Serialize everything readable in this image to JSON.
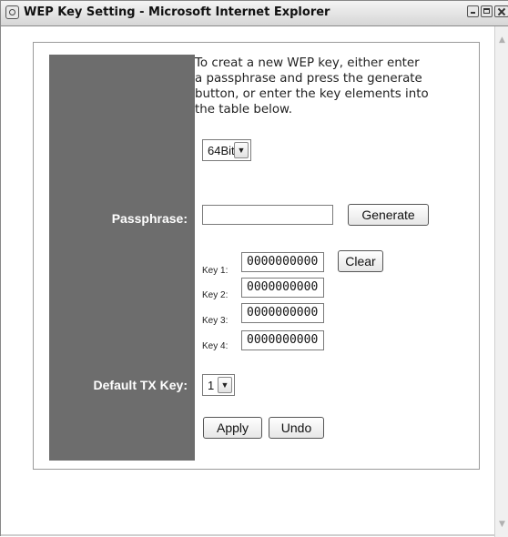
{
  "window": {
    "title": "WEP Key Setting - Microsoft Internet Explorer"
  },
  "scrollbar": {
    "up_arrow": "▲",
    "down_arrow": "▼"
  },
  "form": {
    "instructions": [
      "To creat a new WEP key, either enter",
      "a passphrase and press the generate",
      "button, or enter the key elements into",
      "the table below."
    ],
    "key_length": {
      "selected": "64Bit",
      "arrow": "▼"
    },
    "passphrase": {
      "label": "Passphrase:",
      "value": "",
      "generate_label": "Generate"
    },
    "keys": [
      {
        "label": "Key 1:",
        "value": "0000000000"
      },
      {
        "label": "Key 2:",
        "value": "0000000000"
      },
      {
        "label": "Key 3:",
        "value": "0000000000"
      },
      {
        "label": "Key 4:",
        "value": "0000000000"
      }
    ],
    "clear_label": "Clear",
    "default_tx_key": {
      "label": "Default TX Key:",
      "selected": "1",
      "arrow": "▼"
    },
    "apply_label": "Apply",
    "undo_label": "Undo"
  },
  "icons": {
    "window_icon": "ie-page-icon",
    "minimize": "minimize-icon",
    "maximize": "maximize-icon",
    "close": "close-icon"
  }
}
